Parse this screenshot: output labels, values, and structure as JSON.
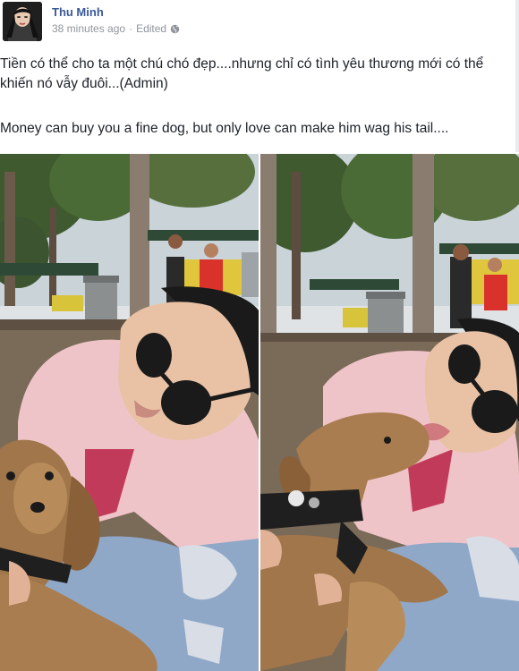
{
  "post": {
    "author": "Thu Minh",
    "timestamp": "38 minutes ago",
    "separator": "·",
    "edited_label": "Edited",
    "privacy_icon": "globe-icon",
    "text_vietnamese": "Tiền có thể cho ta một chú chó đẹp....nhưng chỉ có tình yêu thương mới có thể khiến nó vẫy đuôi...(Admin)",
    "text_english": "Money can buy you a fine dog, but only love can make him wag his tail....",
    "photos": [
      {
        "icon": "photo-woman-with-dog"
      },
      {
        "icon": "photo-woman-kissed-by-dog"
      }
    ]
  },
  "colors": {
    "link": "#3b5998",
    "meta": "#90949c",
    "text": "#1d2129"
  }
}
